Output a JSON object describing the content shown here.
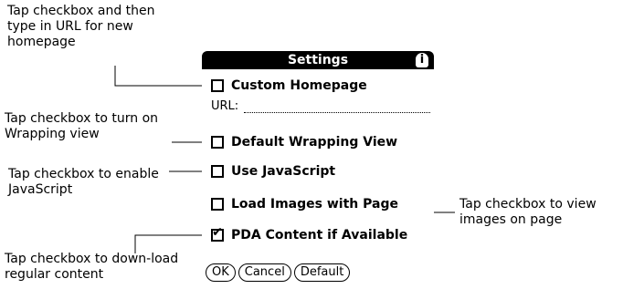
{
  "callouts": {
    "homepage": "Tap checkbox and then type in URL for new homepage",
    "wrapping": "Tap checkbox to turn on Wrapping view",
    "javascript": "Tap checkbox to enable JavaScript",
    "images": "Tap checkbox to view images on page",
    "pda": "Tap checkbox to down-load regular content"
  },
  "dialog": {
    "title": "Settings",
    "info_icon": "i",
    "options": [
      {
        "label": "Custom Homepage",
        "checked": false
      },
      {
        "label": "Default Wrapping View",
        "checked": false
      },
      {
        "label": "Use JavaScript",
        "checked": false
      },
      {
        "label": "Load Images with Page",
        "checked": false
      },
      {
        "label": "PDA Content if Available",
        "checked": true
      }
    ],
    "url_label": "URL:",
    "url_value": "",
    "buttons": {
      "ok": "OK",
      "cancel": "Cancel",
      "default": "Default"
    }
  }
}
